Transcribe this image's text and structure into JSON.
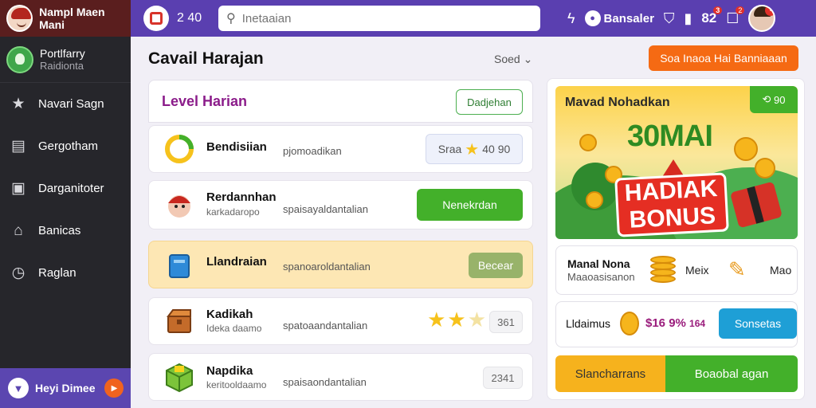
{
  "sidebar": {
    "app_name": "Nampl Maen Mani",
    "profile": {
      "name": "Portlfarry",
      "sub": "Raidionta"
    },
    "items": [
      {
        "label": "Navari Sagn",
        "icon": "star-icon"
      },
      {
        "label": "Gergotham",
        "icon": "wallet-icon"
      },
      {
        "label": "Darganitoter",
        "icon": "calendar-icon"
      },
      {
        "label": "Banicas",
        "icon": "home-icon"
      },
      {
        "label": "Raglan",
        "icon": "clock-icon"
      }
    ],
    "bottom": {
      "label": "Heyi Dimee"
    }
  },
  "topbar": {
    "counter": "2 40",
    "search_placeholder": "Inetaaian",
    "user_label": "Bansaler",
    "num_label": "82",
    "num_badge": "3",
    "notif_badge": "2"
  },
  "main": {
    "title": "Cavail Harajan",
    "sort_label": "Soed",
    "cta_label": "Soa Inaoa Hai Banniaaan",
    "panel": {
      "title": "Level Harian",
      "button": "Dadjehan"
    },
    "rows": [
      {
        "title": "Bendisiian",
        "sub": "",
        "desc": "pjomoadikan",
        "pill": "Sraa",
        "pill_value": "40 90"
      },
      {
        "title": "Rerdannhan",
        "sub": "karkadaropo",
        "desc": "spaisayaldantalian",
        "button": "Nenekrdan"
      },
      {
        "title": "Llandraian",
        "sub": "",
        "desc": "spanoaroldantalian",
        "button": "Becear"
      },
      {
        "title": "Kadikah",
        "sub": "Ideka daamo",
        "desc": "spatoaandantalian",
        "stars": 3,
        "pill": "361"
      },
      {
        "title": "Napdika",
        "sub": "keritooldaamo",
        "desc": "spaisaondantalian",
        "pill": "2341"
      }
    ]
  },
  "rightpanel": {
    "banner": {
      "title": "Mavad Nohadkan",
      "tag": "90",
      "big_text": "30MAI",
      "bonus_line1": "HADIAK",
      "bonus_line2": "BONUS"
    },
    "card1": {
      "title": "Manal Nona",
      "sub": "Maaoasisanon",
      "label1": "Meix",
      "label2": "Mao"
    },
    "card2": {
      "title": "Lldaimus",
      "value": "$16 9%",
      "value_suffix": "164",
      "button": "Sonsetas"
    },
    "buttons": {
      "left": "Slancharrans",
      "right": "Boaobal agan"
    }
  }
}
